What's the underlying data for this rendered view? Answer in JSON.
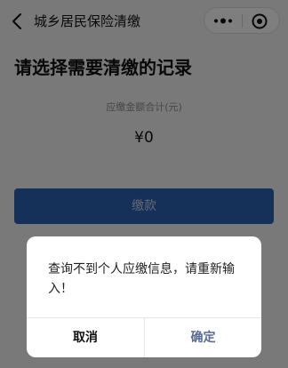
{
  "navbar": {
    "title": "城乡居民保险清缴",
    "back_icon": "chevron-left-icon",
    "more_icon": "more-dots-icon",
    "close_icon": "target-close-icon"
  },
  "main": {
    "heading": "请选择需要清缴的记录",
    "total_label": "应缴金额合计(元)",
    "total_amount": "¥0",
    "pay_button_label": "缴款"
  },
  "dialog": {
    "message": "查询不到个人应缴信息，请重新输入！",
    "cancel_label": "取消",
    "confirm_label": "确定"
  },
  "colors": {
    "pay_button": "#2d63b3",
    "confirm_text": "#576b95"
  }
}
